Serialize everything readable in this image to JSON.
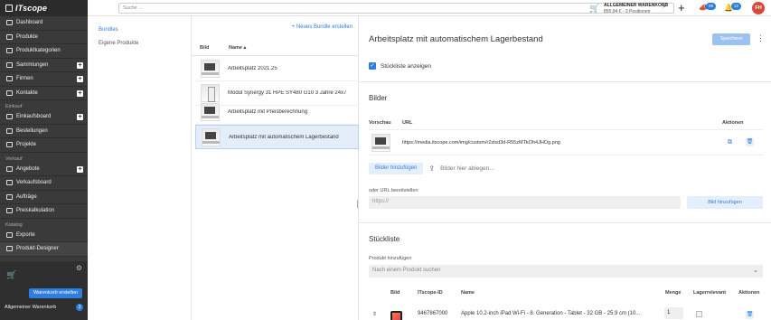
{
  "brand": {
    "name": "ITscope"
  },
  "sidebar": {
    "items_top": [
      {
        "label": "Dashboard",
        "plus": false
      },
      {
        "label": "Produkte",
        "plus": false
      },
      {
        "label": "Produktkategorien",
        "plus": false
      },
      {
        "label": "Sammlungen",
        "plus": true
      },
      {
        "label": "Firmen",
        "plus": true
      },
      {
        "label": "Kontakte",
        "plus": true
      }
    ],
    "section_einkauf": "Einkauf",
    "items_einkauf": [
      {
        "label": "Einkaufsboard",
        "plus": true
      },
      {
        "label": "Bestellungen",
        "plus": false
      },
      {
        "label": "Projekte",
        "plus": false
      }
    ],
    "section_verkauf": "Verkauf",
    "items_verkauf": [
      {
        "label": "Angebote",
        "plus": true
      },
      {
        "label": "Verkaufsboard",
        "plus": false
      },
      {
        "label": "Aufträge",
        "plus": false
      },
      {
        "label": "Preiskalkulation",
        "plus": false
      }
    ],
    "section_katalog": "Katalog",
    "items_katalog": [
      {
        "label": "Exporte",
        "plus": false
      },
      {
        "label": "Produkt-Designer",
        "plus": false
      }
    ],
    "cart_button": "Warenkorb erstellen",
    "cart_name": "Allgemeiner Warenkorb",
    "cart_count": "3"
  },
  "topbar": {
    "search_placeholder": "Suche ...",
    "cart_title": "ALLGEMEINER WARENKORB",
    "cart_sub": "855,94 € - 3 Positionen",
    "bell_badge": "99",
    "notif_badge": "12",
    "avatar": "FH"
  },
  "tabs": [
    "Bundles",
    "Eigene Produkte"
  ],
  "list": {
    "new_button": "+ Neues Bundle erstellen",
    "col_image": "Bild",
    "col_name": "Name",
    "rows": [
      "Arbeitsplatz 2021.25",
      "Modul Synergy 31 HPE SY480 G10 3 Jahre 24x7",
      "Arbeitsplatz mit Preisberechnung",
      "Arbeitsplatz mit automatischem Lagerbestand"
    ]
  },
  "detail": {
    "title": "Arbeitsplatz mit automatischem Lagerbestand",
    "save": "Speichern",
    "checkbox_label": "Stückliste anzeigen",
    "images_title": "Bilder",
    "col_preview": "Vorschau",
    "col_url": "URL",
    "col_actions": "Aktionen",
    "image_url": "https://media.itscope.com/img/custom/r2zlsd3d-R55zMTkOh4JHOg.png",
    "upload_button": "Bilder hinzufügen",
    "drop_text": "Bilder hier ablegen...",
    "url_label": "oder URL bereitstellen",
    "url_placeholder": "https://",
    "url_add_button": "Bild hinzufügen",
    "bom_title": "Stückliste",
    "add_product_label": "Produkt hinzufügen",
    "product_placeholder": "Nach einem Produkt suchen",
    "bom_cols": {
      "image": "Bild",
      "id": "ITscope-ID",
      "name": "Name",
      "qty": "Menge",
      "stock": "Lagerrelevant",
      "actions": "Aktionen"
    },
    "bom_row": {
      "id": "9467867000",
      "name": "Apple 10.2-inch iPad Wi-Fi - 8. Generation - Tablet - 32 GB - 25.9 cm (10...",
      "qty": "1"
    }
  }
}
